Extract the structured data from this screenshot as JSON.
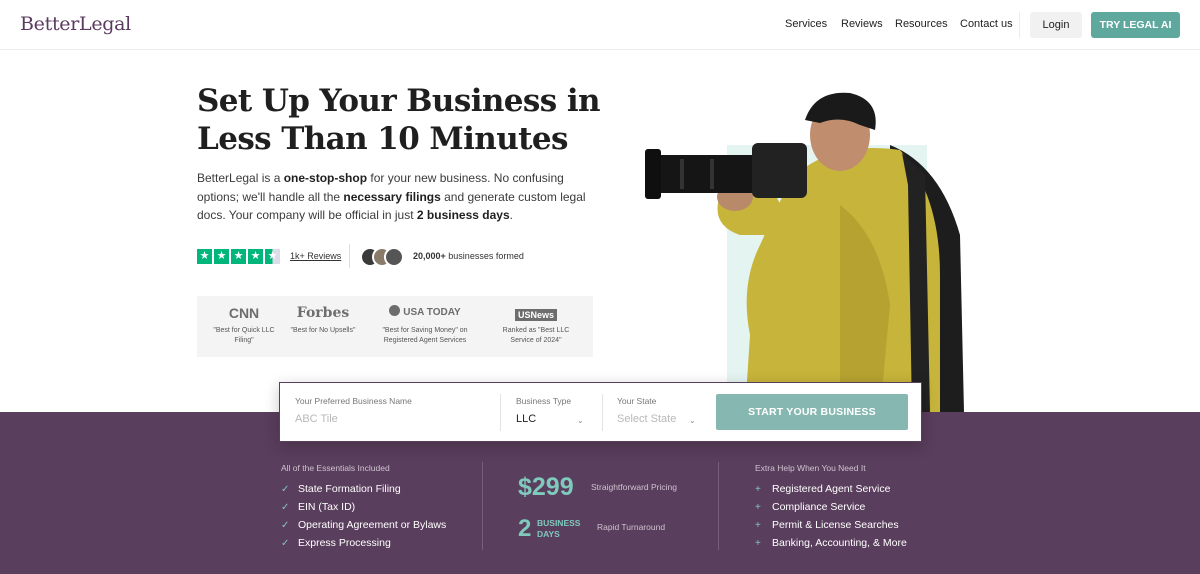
{
  "header": {
    "logo": "BetterLegal",
    "nav": [
      "Services",
      "Reviews",
      "Resources",
      "Contact us"
    ],
    "login_label": "Login",
    "legal_ai_label": "TRY LEGAL AI",
    "accent_color": "#5fa89e"
  },
  "hero": {
    "title": "Set Up Your Business in Less Than 10 Minutes",
    "desc_1": "BetterLegal is a ",
    "desc_bold_1": "one-stop-shop",
    "desc_2": " for your new business. No confusing options; we'll handle all the ",
    "desc_bold_2": "necessary filings",
    "desc_3": " and generate custom legal docs. Your company will be official in just ",
    "desc_bold_3": "2 business days",
    "desc_4": ".",
    "rating": 4.5,
    "reviews_link": "1k+ Reviews",
    "businesses_count": "20,000+",
    "businesses_suffix": " businesses formed"
  },
  "press": [
    {
      "logo": "CNN",
      "quote": "\"Best for Quick LLC Filing\""
    },
    {
      "logo": "Forbes",
      "quote": "\"Best for No Upsells\""
    },
    {
      "logo": "USA TODAY",
      "quote": "\"Best for Saving Money\" on Registered Agent Services"
    },
    {
      "logo": "USNews",
      "quote": "Ranked as \"Best LLC Service of 2024\""
    }
  ],
  "form": {
    "name_label": "Your Preferred Business Name",
    "name_placeholder": "ABC Tile",
    "type_label": "Business Type",
    "type_value": "LLC",
    "state_label": "Your State",
    "state_placeholder": "Select State",
    "submit_label": "START YOUR BUSINESS"
  },
  "band": {
    "essentials_head": "All of the Essentials Included",
    "essentials": [
      "State Formation Filing",
      "EIN (Tax ID)",
      "Operating Agreement or Bylaws",
      "Express Processing"
    ],
    "price": "$299",
    "price_caption": "Straightforward Pricing",
    "days_num": "2",
    "days_word": "BUSINESS DAYS",
    "days_caption": "Rapid Turnaround",
    "extra_head": "Extra Help When You Need It",
    "extras": [
      "Registered Agent Service",
      "Compliance Service",
      "Permit & License Searches",
      "Banking, Accounting, & More"
    ],
    "band_color": "#5a3e5d"
  }
}
